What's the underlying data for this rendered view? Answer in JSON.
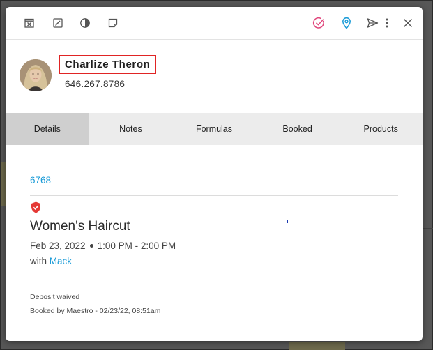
{
  "toolbar": {
    "left_icons": [
      "cancel-calendar-icon",
      "edit-icon",
      "contrast-icon",
      "note-icon"
    ],
    "right_icons": [
      "check-circle-icon",
      "location-pin-icon",
      "send-icon",
      "more-vertical-icon",
      "close-icon"
    ],
    "accent_check": "#e0457b",
    "accent_pin": "#1a9bd7"
  },
  "client": {
    "name": "Charlize Theron",
    "phone": "646.267.8786"
  },
  "tabs": [
    {
      "label": "Details",
      "active": true
    },
    {
      "label": "Notes",
      "active": false
    },
    {
      "label": "Formulas",
      "active": false
    },
    {
      "label": "Booked",
      "active": false
    },
    {
      "label": "Products",
      "active": false
    }
  ],
  "appointment": {
    "id": "6768",
    "service": "Women's Haircut",
    "date": "Feb 23, 2022",
    "time": "1:00 PM - 2:00 PM",
    "with_prefix": "with",
    "staff": "Mack",
    "deposit": "Deposit waived",
    "booked_by": "Booked by Maestro - 02/23/22, 08:51am"
  },
  "colors": {
    "link": "#1a9bd7",
    "highlight_border": "#e02424",
    "shield": "#e53935",
    "active_tab": "#cfcfcf",
    "tab_bar": "#ececec"
  }
}
